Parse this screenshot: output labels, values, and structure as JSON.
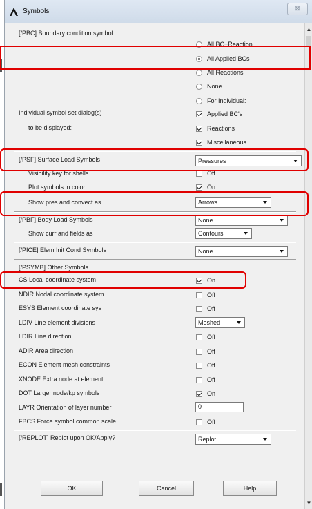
{
  "window": {
    "title": "Symbols",
    "close_glyph": "⊠"
  },
  "pbc": {
    "label": "[/PBC] Boundary condition symbol",
    "options": [
      "All BC+Reaction",
      "All Applied BCs",
      "All Reactions",
      "None",
      "For Individual:"
    ],
    "selected": "All Applied BCs",
    "dialog_label_1": "Individual symbol set dialog(s)",
    "dialog_label_2": "to be displayed:",
    "checks": [
      {
        "label": "Applied BC's",
        "checked": true
      },
      {
        "label": "Reactions",
        "checked": true
      },
      {
        "label": "Miscellaneous",
        "checked": true
      }
    ]
  },
  "psf": {
    "label": "[/PSF]  Surface Load Symbols",
    "value": "Pressures",
    "shells_label": "Visibility key for shells",
    "shells_value": "Off",
    "shells_checked": false,
    "color_label": "Plot symbols in color",
    "color_value": "On",
    "color_checked": true,
    "pres_label": "Show pres and convect as",
    "pres_value": "Arrows"
  },
  "pbf": {
    "label": "[/PBF]  Body Load Symbols",
    "value": "None",
    "curr_label": "Show curr and fields as",
    "curr_value": "Contours"
  },
  "pice": {
    "label": "[/PICE] Elem Init Cond Symbols",
    "value": "None"
  },
  "psymb": {
    "label": "[/PSYMB] Other Symbols",
    "items": [
      {
        "label": "CS  Local coordinate system",
        "value": "On",
        "checked": true
      },
      {
        "label": "NDIR Nodal coordinate system",
        "value": "Off",
        "checked": false
      },
      {
        "label": "ESYS Element coordinate sys",
        "value": "Off",
        "checked": false
      }
    ],
    "ldiv_label": "LDIV  Line element divisions",
    "ldiv_value": "Meshed",
    "items2": [
      {
        "label": "LDIR Line direction",
        "value": "Off",
        "checked": false
      },
      {
        "label": "ADIR Area direction",
        "value": "Off",
        "checked": false
      },
      {
        "label": "ECON Element mesh constraints",
        "value": "Off",
        "checked": false
      },
      {
        "label": "XNODE Extra node at element",
        "value": "Off",
        "checked": false
      },
      {
        "label": "DOT  Larger node/kp symbols",
        "value": "On",
        "checked": true
      }
    ],
    "layr_label": "LAYR Orientation of layer number",
    "layr_value": "0",
    "fbcs_label": "FBCS Force symbol common scale",
    "fbcs_value": "Off",
    "fbcs_checked": false
  },
  "replot": {
    "label": "[/REPLOT] Replot upon OK/Apply?",
    "value": "Replot"
  },
  "buttons": {
    "ok": "OK",
    "cancel": "Cancel",
    "help": "Help"
  },
  "colors": {
    "highlight": "#e00000",
    "dialog_bg": "#f0f0f0"
  }
}
